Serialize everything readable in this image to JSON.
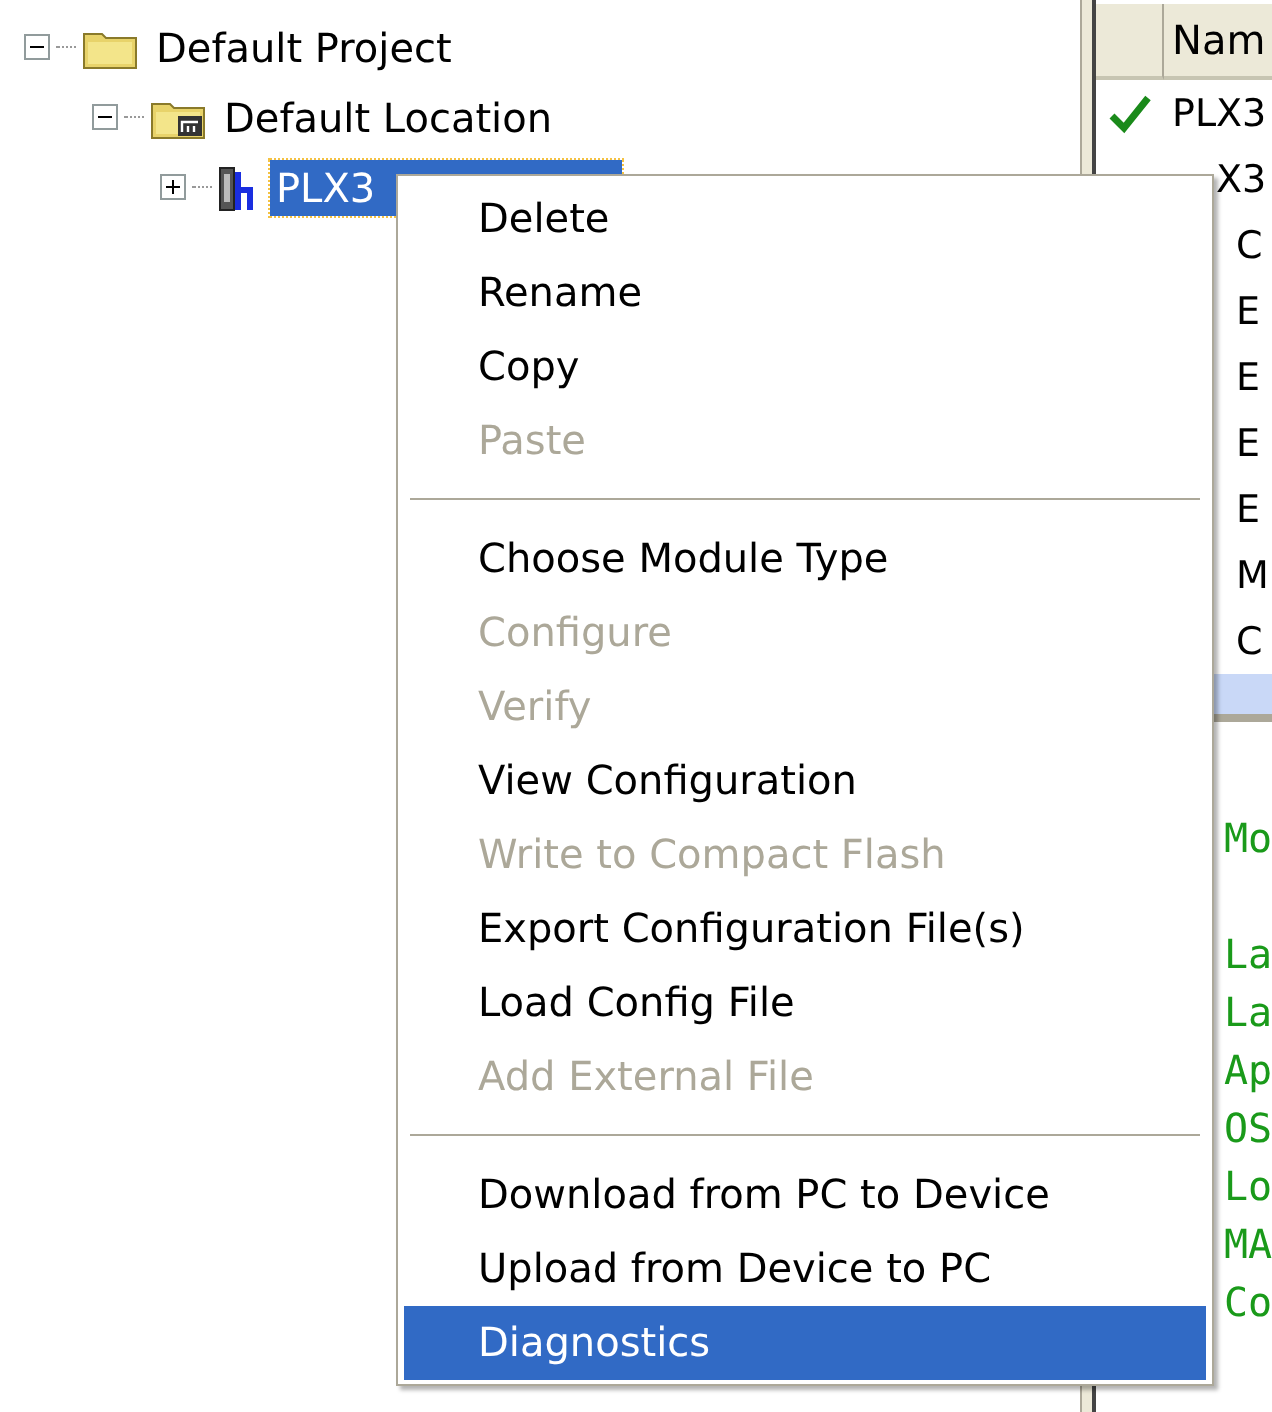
{
  "tree": [
    {
      "label": "Default Project",
      "expanded": true,
      "selected": false,
      "children": [
        {
          "label": "Default Location",
          "expanded": true,
          "selected": false,
          "children": [
            {
              "label": "PLX3",
              "expanded": false,
              "selected": true
            }
          ]
        }
      ]
    }
  ],
  "list": {
    "columns": [
      "Nam"
    ],
    "rows": [
      {
        "text": "PLX3",
        "checked": true
      },
      {
        "text": "X3",
        "checked": false,
        "children": [
          {
            "text": "C"
          },
          {
            "text": "E"
          },
          {
            "text": "E"
          },
          {
            "text": "E"
          },
          {
            "text": "E"
          },
          {
            "text": "M"
          },
          {
            "text": "C"
          }
        ]
      }
    ]
  },
  "log": {
    "blocks": [
      [
        "Mo"
      ],
      [
        "La",
        "La",
        "Ap",
        "OS",
        "Lo",
        "MA",
        "Co"
      ]
    ]
  },
  "context_menu": {
    "items": [
      {
        "kind": "item",
        "label": "Delete",
        "disabled": false,
        "selected": false
      },
      {
        "kind": "item",
        "label": "Rename",
        "disabled": false,
        "selected": false
      },
      {
        "kind": "item",
        "label": "Copy",
        "disabled": false,
        "selected": false
      },
      {
        "kind": "item",
        "label": "Paste",
        "disabled": true,
        "selected": false
      },
      {
        "kind": "separator"
      },
      {
        "kind": "item",
        "label": "Choose Module Type",
        "disabled": false,
        "selected": false
      },
      {
        "kind": "item",
        "label": "Configure",
        "disabled": true,
        "selected": false
      },
      {
        "kind": "item",
        "label": "Verify",
        "disabled": true,
        "selected": false
      },
      {
        "kind": "item",
        "label": "View Configuration",
        "disabled": false,
        "selected": false
      },
      {
        "kind": "item",
        "label": "Write to Compact Flash",
        "disabled": true,
        "selected": false
      },
      {
        "kind": "item",
        "label": "Export Configuration File(s)",
        "disabled": false,
        "selected": false
      },
      {
        "kind": "item",
        "label": "Load Config File",
        "disabled": false,
        "selected": false
      },
      {
        "kind": "item",
        "label": "Add External File",
        "disabled": true,
        "selected": false
      },
      {
        "kind": "separator"
      },
      {
        "kind": "item",
        "label": "Download from PC to Device",
        "disabled": false,
        "selected": false
      },
      {
        "kind": "item",
        "label": "Upload from Device to PC",
        "disabled": false,
        "selected": false
      },
      {
        "kind": "item",
        "label": "Diagnostics",
        "disabled": false,
        "selected": true
      }
    ]
  }
}
